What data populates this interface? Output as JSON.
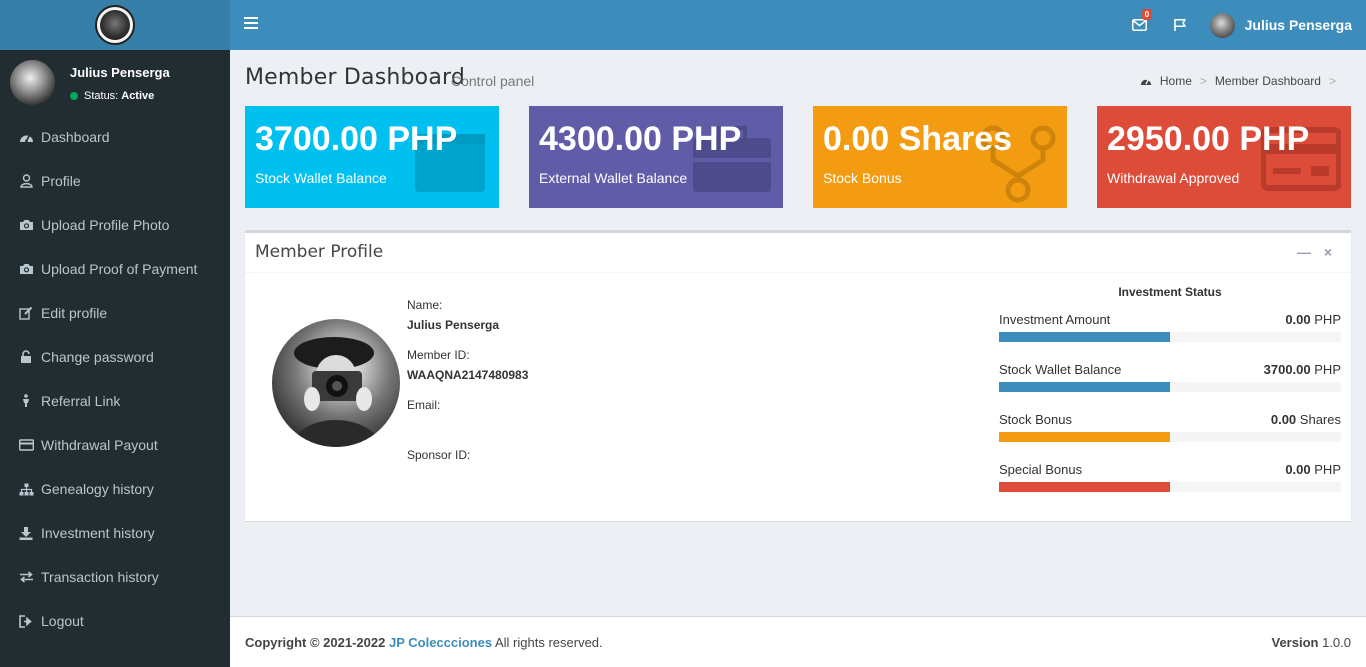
{
  "topbar": {
    "user_name": "Julius Penserga",
    "mail_badge": "0"
  },
  "sidebar": {
    "user_name": "Julius Penserga",
    "status_label": "Status:",
    "status_value": "Active",
    "items": [
      {
        "label": "Dashboard",
        "icon": "dashboard-icon"
      },
      {
        "label": "Profile",
        "icon": "user-icon"
      },
      {
        "label": "Upload Profile Photo",
        "icon": "camera-icon"
      },
      {
        "label": "Upload Proof of Payment",
        "icon": "camera-icon"
      },
      {
        "label": "Edit profile",
        "icon": "edit-icon"
      },
      {
        "label": "Change password",
        "icon": "lock-icon"
      },
      {
        "label": "Referral Link",
        "icon": "person-icon"
      },
      {
        "label": "Withdrawal Payout",
        "icon": "credit-card-icon"
      },
      {
        "label": "Genealogy history",
        "icon": "sitemap-icon"
      },
      {
        "label": "Investment history",
        "icon": "download-icon"
      },
      {
        "label": "Transaction history",
        "icon": "exchange-icon"
      },
      {
        "label": "Logout",
        "icon": "sign-out-icon"
      }
    ]
  },
  "header": {
    "title": "Member Dashboard",
    "subtitle": "Control panel",
    "breadcrumb": [
      "Home",
      "Member Dashboard"
    ]
  },
  "info_boxes": [
    {
      "value": "3700.00 PHP",
      "label": "Stock Wallet Balance",
      "color": "#00c0ef",
      "icon": "wallet-icon"
    },
    {
      "value": "4300.00 PHP",
      "label": "External Wallet Balance",
      "color": "#605ca8",
      "icon": "briefcase-icon"
    },
    {
      "value": "0.00 Shares",
      "label": "Stock Bonus",
      "color": "#f39c12",
      "icon": "network-icon"
    },
    {
      "value": "2950.00 PHP",
      "label": "Withdrawal Approved",
      "color": "#dd4b39",
      "icon": "credit-card-icon"
    }
  ],
  "profile": {
    "title": "Member Profile",
    "name_label": "Name:",
    "name_value": "Julius Penserga",
    "member_id_label": "Member ID:",
    "member_id_value": "WAAQNA2147480983",
    "email_label": "Email:",
    "email_value": "",
    "sponsor_label": "Sponsor ID:",
    "sponsor_value": ""
  },
  "investment": {
    "title": "Investment Status",
    "rows": [
      {
        "label": "Investment Amount",
        "amount": "0.00",
        "unit": "PHP",
        "color": "#3c8dbc",
        "fill": 0.5
      },
      {
        "label": "Stock Wallet Balance",
        "amount": "3700.00",
        "unit": "PHP",
        "color": "#3c8dbc",
        "fill": 0.5
      },
      {
        "label": "Stock Bonus",
        "amount": "0.00",
        "unit": "Shares",
        "color": "#f39c12",
        "fill": 0.5
      },
      {
        "label": "Special Bonus",
        "amount": "0.00",
        "unit": "PHP",
        "color": "#dd4b39",
        "fill": 0.5
      }
    ]
  },
  "footer": {
    "copyright": "Copyright © 2021-2022",
    "brand": "JP Coleccciones",
    "rights": "All rights reserved.",
    "version_label": "Version",
    "version_value": "1.0.0"
  }
}
